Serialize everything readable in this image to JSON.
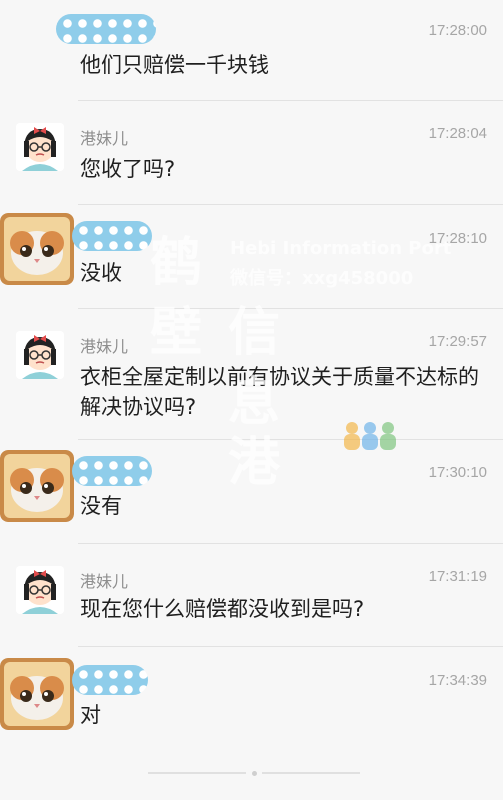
{
  "messages": [
    {
      "sender": "",
      "time": "17:28:00",
      "text": "他们只赔偿一千块钱"
    },
    {
      "sender": "港妹儿",
      "time": "17:28:04",
      "text": "您收了吗?"
    },
    {
      "sender": "",
      "time": "17:28:10",
      "text": "没收"
    },
    {
      "sender": "港妹儿",
      "time": "17:29:57",
      "text": "衣柜全屋定制以前有协议关于质量不达标的解决协议吗?"
    },
    {
      "sender": "",
      "time": "17:30:10",
      "text": "没有"
    },
    {
      "sender": "港妹儿",
      "time": "17:31:19",
      "text": "现在您什么赔偿都没收到是吗?"
    },
    {
      "sender": "",
      "time": "17:34:39",
      "text": "对"
    }
  ],
  "watermark": {
    "chars": [
      "鹤",
      "壁",
      "信",
      "息",
      "港"
    ],
    "en": "Hebi Information Port",
    "wechat": "微信号：xxg458000"
  },
  "colors": {
    "background": "#f7f7f7",
    "mask": "#8fcdea",
    "time": "#a6a6a6"
  }
}
